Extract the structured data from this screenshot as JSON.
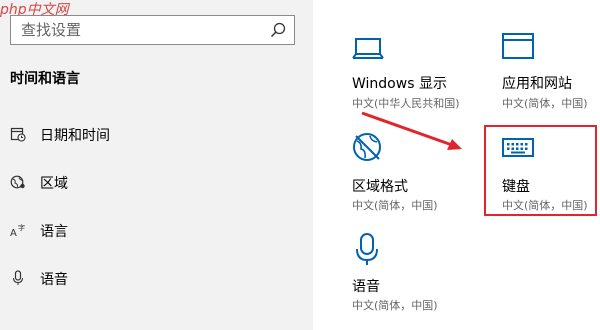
{
  "watermark": "php中文网",
  "search": {
    "placeholder": "查找设置",
    "icon": "search-icon"
  },
  "sidebar": {
    "section_title": "时间和语言",
    "items": [
      {
        "label": "日期和时间",
        "icon": "date-time-icon"
      },
      {
        "label": "区域",
        "icon": "region-icon"
      },
      {
        "label": "语言",
        "icon": "language-icon"
      },
      {
        "label": "语音",
        "icon": "microphone-icon"
      }
    ]
  },
  "tiles": [
    {
      "title": "Windows 显示",
      "subtitle": "中文(中华人民共和国)",
      "icon": "laptop-icon"
    },
    {
      "title": "应用和网站",
      "subtitle": "中文(简体，中国)",
      "icon": "browser-window-icon"
    },
    {
      "title": "区域格式",
      "subtitle": "中文(简体，中国)",
      "icon": "region-format-icon"
    },
    {
      "title": "键盘",
      "subtitle": "中文(简体，中国)",
      "icon": "keyboard-icon"
    },
    {
      "title": "语音",
      "subtitle": "中文(简体，中国)",
      "icon": "microphone-icon"
    }
  ],
  "colors": {
    "accent": "#0063b1",
    "annotation": "#e0262d",
    "sidebar_bg": "#f2f2f2"
  }
}
